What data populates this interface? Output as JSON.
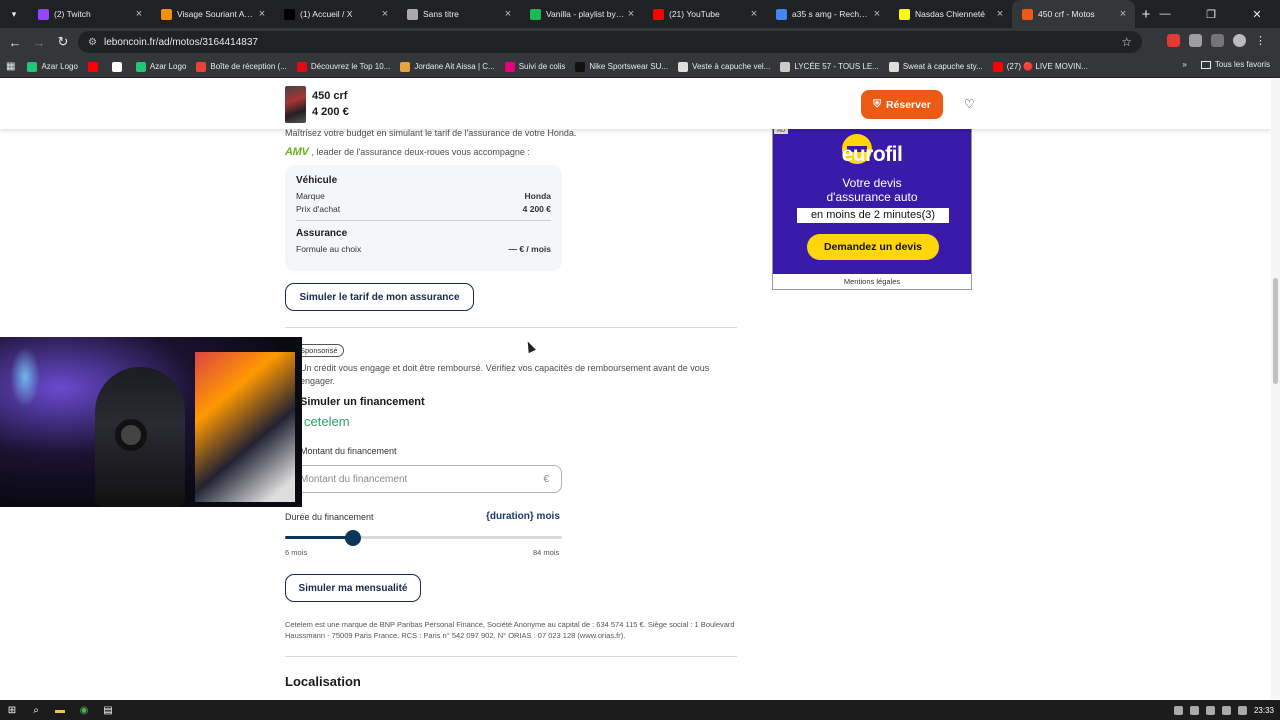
{
  "browser": {
    "tabs": [
      {
        "title": "(2) Twitch",
        "color": "#9146ff",
        "active": false
      },
      {
        "title": "Visage Souriant Avec",
        "color": "#f29111",
        "active": false
      },
      {
        "title": "(1) Accueil / X",
        "color": "#000000",
        "active": false
      },
      {
        "title": "Sans titre",
        "color": "#aaaaaa",
        "active": false
      },
      {
        "title": "Vanilla - playlist by Je",
        "color": "#1db954",
        "active": false
      },
      {
        "title": "(21) YouTube",
        "color": "#ff0000",
        "active": false
      },
      {
        "title": "a35 s amg - Recherche",
        "color": "#4285f4",
        "active": false
      },
      {
        "title": "Nasdas Chienneté",
        "color": "#fffc00",
        "active": false
      },
      {
        "title": "450 crf - Motos",
        "color": "#ec5a13",
        "active": true
      }
    ],
    "url": "leboncoin.fr/ad/motos/3164414837",
    "bookmarks": [
      {
        "label": "Azar Logo",
        "color": "#1dc974"
      },
      {
        "label": "",
        "color": "#ff0000"
      },
      {
        "label": "",
        "color": "#ffffff"
      },
      {
        "label": "Azar Logo",
        "color": "#1dc974"
      },
      {
        "label": "Boîte de réception (...",
        "color": "#ea4335"
      },
      {
        "label": "Découvrez le Top 10...",
        "color": "#e50914"
      },
      {
        "label": "Jordane Ait Aissa | C...",
        "color": "#e8a23d"
      },
      {
        "label": "Suivi de colis",
        "color": "#e6007e"
      },
      {
        "label": "Nike Sportswear SU...",
        "color": "#111111"
      },
      {
        "label": "Veste à capuche vel...",
        "color": "#dddddd"
      },
      {
        "label": "LYCÉE 57 - TOUS LE...",
        "color": "#cccccc"
      },
      {
        "label": "Sweat à capuche sty...",
        "color": "#dddddd"
      },
      {
        "label": "(27) 🔴 LIVE MOVIN...",
        "color": "#ff0000"
      }
    ],
    "all_bookmarks": "Tous les favoris"
  },
  "sticky": {
    "title": "450 crf",
    "price": "4 200 €",
    "reserve_label": "Réserver"
  },
  "insurance": {
    "intro": "Maîtrisez votre budget en simulant le tarif de l'assurance de votre Honda.",
    "partner_logo": "AMV",
    "partner_text": ", leader de l'assurance deux-roues vous accompagne :",
    "vehicle_heading": "Véhicule",
    "brand_label": "Marque",
    "brand_value": "Honda",
    "price_label": "Prix d'achat",
    "price_value": "4 200 €",
    "ins_heading": "Assurance",
    "formula_label": "Formule au choix",
    "formula_value": "— € / mois",
    "simulate_button": "Simuler le tarif de mon assurance"
  },
  "financing": {
    "badge": "Sponsorisé",
    "credit_text": "Un crédit vous engage et doit être remboursé. Vérifiez vos capacités de remboursement avant de vous engager.",
    "heading": "Simuler un financement",
    "partner": "cetelem",
    "amount_label": "Montant du financement",
    "amount_placeholder": "Montant du financement",
    "currency": "€",
    "duration_label": "Durée du financement",
    "duration_value": "{duration} mois",
    "slider_min": "6 mois",
    "slider_max": "84 mois",
    "slider_fraction": 0.245,
    "simulate_button": "Simuler ma mensualité",
    "legal": "Cetelem est une marque de BNP Paribas Personal Finance, Société Anonyme au capital de : 634 574 115 €. Siège social : 1 Boulevard Haussmann - 75009 Paris France. RCS : Paris n° 542 097 902. N° ORIAS : 07 023 128 (www.orias.fr)."
  },
  "location_heading": "Localisation",
  "ad": {
    "tag": "AD",
    "logo": "eurofil",
    "line1": "Votre devis",
    "line2": "d'assurance auto",
    "line3": "en moins de 2 minutes(3)",
    "cta": "Demandez un devis",
    "footer": "Mentions légales"
  },
  "taskbar": {
    "time": "23:33"
  }
}
